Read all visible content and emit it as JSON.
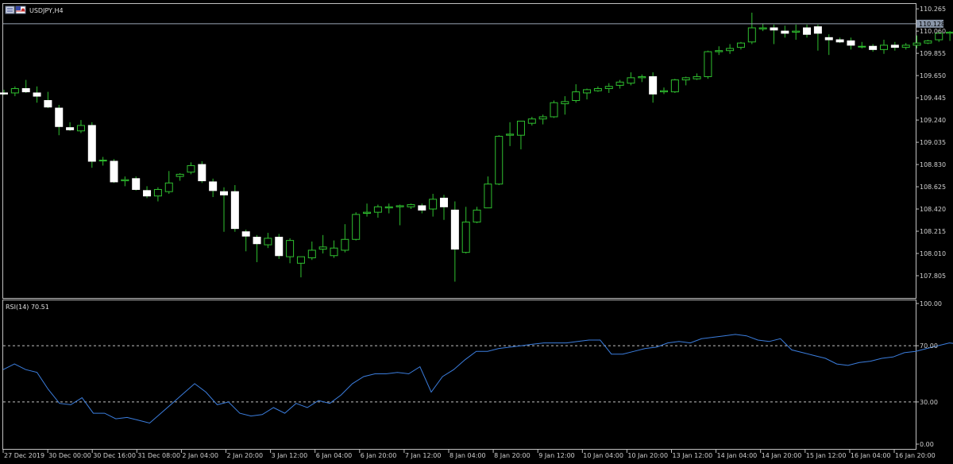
{
  "symbol_label": "USDJPY,H4",
  "rsi_label": "RSI(14) 70.51",
  "current_price_label": "110.128",
  "colors": {
    "background": "#000000",
    "frame": "#c0c0c0",
    "bull_fill": "#000000",
    "bull_stroke": "#2fbf2f",
    "bear_fill": "#ffffff",
    "wick": "#2fbf2f",
    "rsi_line": "#3b7ddd",
    "level_line": "#c0c0c0",
    "price_line": "#9aa7b6"
  },
  "chart_data": [
    {
      "type": "candlestick",
      "title": "USDJPY,H4",
      "ylim": [
        107.6,
        110.31
      ],
      "y_ticks": [
        "110.265",
        "110.060",
        "109.855",
        "109.650",
        "109.445",
        "109.240",
        "109.035",
        "108.830",
        "108.625",
        "108.420",
        "108.215",
        "108.010",
        "107.805"
      ],
      "current_price": 110.128,
      "x_tick_labels": [
        "27 Dec 2019",
        "30 Dec 00:00",
        "30 Dec 16:00",
        "31 Dec 08:00",
        "2 Jan 04:00",
        "2 Jan 20:00",
        "3 Jan 12:00",
        "6 Jan 04:00",
        "6 Jan 20:00",
        "7 Jan 12:00",
        "8 Jan 04:00",
        "8 Jan 20:00",
        "9 Jan 12:00",
        "10 Jan 04:00",
        "10 Jan 20:00",
        "13 Jan 12:00",
        "14 Jan 04:00",
        "14 Jan 20:00",
        "15 Jan 12:00",
        "16 Jan 04:00",
        "16 Jan 20:00"
      ],
      "candles": [
        {
          "o": 109.49,
          "h": 109.52,
          "l": 109.47,
          "c": 109.48
        },
        {
          "o": 109.49,
          "h": 109.55,
          "l": 109.46,
          "c": 109.53
        },
        {
          "o": 109.53,
          "h": 109.61,
          "l": 109.49,
          "c": 109.5
        },
        {
          "o": 109.49,
          "h": 109.55,
          "l": 109.4,
          "c": 109.46
        },
        {
          "o": 109.42,
          "h": 109.5,
          "l": 109.35,
          "c": 109.36
        },
        {
          "o": 109.35,
          "h": 109.38,
          "l": 109.1,
          "c": 109.18
        },
        {
          "o": 109.17,
          "h": 109.22,
          "l": 109.14,
          "c": 109.15
        },
        {
          "o": 109.14,
          "h": 109.24,
          "l": 109.12,
          "c": 109.19
        },
        {
          "o": 109.19,
          "h": 109.22,
          "l": 108.8,
          "c": 108.86
        },
        {
          "o": 108.87,
          "h": 108.9,
          "l": 108.82,
          "c": 108.87
        },
        {
          "o": 108.86,
          "h": 108.88,
          "l": 108.66,
          "c": 108.67
        },
        {
          "o": 108.68,
          "h": 108.72,
          "l": 108.63,
          "c": 108.69
        },
        {
          "o": 108.7,
          "h": 108.72,
          "l": 108.59,
          "c": 108.6
        },
        {
          "o": 108.59,
          "h": 108.63,
          "l": 108.52,
          "c": 108.54
        },
        {
          "o": 108.54,
          "h": 108.62,
          "l": 108.49,
          "c": 108.6
        },
        {
          "o": 108.58,
          "h": 108.77,
          "l": 108.56,
          "c": 108.66
        },
        {
          "o": 108.72,
          "h": 108.75,
          "l": 108.68,
          "c": 108.74
        },
        {
          "o": 108.76,
          "h": 108.85,
          "l": 108.74,
          "c": 108.82
        },
        {
          "o": 108.83,
          "h": 108.86,
          "l": 108.66,
          "c": 108.68
        },
        {
          "o": 108.67,
          "h": 108.7,
          "l": 108.53,
          "c": 108.59
        },
        {
          "o": 108.58,
          "h": 108.62,
          "l": 108.21,
          "c": 108.55
        },
        {
          "o": 108.58,
          "h": 108.64,
          "l": 108.21,
          "c": 108.24
        },
        {
          "o": 108.21,
          "h": 108.23,
          "l": 108.03,
          "c": 108.17
        },
        {
          "o": 108.16,
          "h": 108.18,
          "l": 107.93,
          "c": 108.1
        },
        {
          "o": 108.09,
          "h": 108.2,
          "l": 108.06,
          "c": 108.15
        },
        {
          "o": 108.16,
          "h": 108.19,
          "l": 107.96,
          "c": 107.99
        },
        {
          "o": 107.98,
          "h": 108.15,
          "l": 107.92,
          "c": 108.13
        },
        {
          "o": 107.92,
          "h": 107.96,
          "l": 107.79,
          "c": 107.98
        },
        {
          "o": 107.97,
          "h": 108.12,
          "l": 107.95,
          "c": 108.04
        },
        {
          "o": 108.05,
          "h": 108.18,
          "l": 108.01,
          "c": 108.07
        },
        {
          "o": 107.99,
          "h": 108.13,
          "l": 107.97,
          "c": 108.06
        },
        {
          "o": 108.04,
          "h": 108.28,
          "l": 108.02,
          "c": 108.14
        },
        {
          "o": 108.14,
          "h": 108.39,
          "l": 108.13,
          "c": 108.37
        },
        {
          "o": 108.38,
          "h": 108.47,
          "l": 108.35,
          "c": 108.39
        },
        {
          "o": 108.39,
          "h": 108.46,
          "l": 108.34,
          "c": 108.44
        },
        {
          "o": 108.43,
          "h": 108.47,
          "l": 108.38,
          "c": 108.44
        },
        {
          "o": 108.44,
          "h": 108.46,
          "l": 108.27,
          "c": 108.45
        },
        {
          "o": 108.44,
          "h": 108.47,
          "l": 108.42,
          "c": 108.46
        },
        {
          "o": 108.45,
          "h": 108.47,
          "l": 108.38,
          "c": 108.41
        },
        {
          "o": 108.42,
          "h": 108.56,
          "l": 108.35,
          "c": 108.51
        },
        {
          "o": 108.52,
          "h": 108.55,
          "l": 108.32,
          "c": 108.44
        },
        {
          "o": 108.41,
          "h": 108.49,
          "l": 107.75,
          "c": 108.05
        },
        {
          "o": 108.02,
          "h": 108.44,
          "l": 108.01,
          "c": 108.3
        },
        {
          "o": 108.3,
          "h": 108.44,
          "l": 108.29,
          "c": 108.41
        },
        {
          "o": 108.43,
          "h": 108.72,
          "l": 108.43,
          "c": 108.65
        },
        {
          "o": 108.65,
          "h": 109.1,
          "l": 108.64,
          "c": 109.09
        },
        {
          "o": 109.1,
          "h": 109.22,
          "l": 109.0,
          "c": 109.11
        },
        {
          "o": 109.1,
          "h": 109.23,
          "l": 108.97,
          "c": 109.23
        },
        {
          "o": 109.21,
          "h": 109.27,
          "l": 109.19,
          "c": 109.25
        },
        {
          "o": 109.25,
          "h": 109.29,
          "l": 109.2,
          "c": 109.27
        },
        {
          "o": 109.27,
          "h": 109.42,
          "l": 109.26,
          "c": 109.4
        },
        {
          "o": 109.39,
          "h": 109.46,
          "l": 109.29,
          "c": 109.41
        },
        {
          "o": 109.42,
          "h": 109.57,
          "l": 109.4,
          "c": 109.5
        },
        {
          "o": 109.49,
          "h": 109.53,
          "l": 109.43,
          "c": 109.52
        },
        {
          "o": 109.51,
          "h": 109.55,
          "l": 109.5,
          "c": 109.53
        },
        {
          "o": 109.53,
          "h": 109.58,
          "l": 109.49,
          "c": 109.55
        },
        {
          "o": 109.56,
          "h": 109.61,
          "l": 109.53,
          "c": 109.59
        },
        {
          "o": 109.58,
          "h": 109.68,
          "l": 109.56,
          "c": 109.63
        },
        {
          "o": 109.63,
          "h": 109.66,
          "l": 109.59,
          "c": 109.64
        },
        {
          "o": 109.64,
          "h": 109.68,
          "l": 109.4,
          "c": 109.48
        },
        {
          "o": 109.5,
          "h": 109.54,
          "l": 109.48,
          "c": 109.51
        },
        {
          "o": 109.5,
          "h": 109.62,
          "l": 109.49,
          "c": 109.61
        },
        {
          "o": 109.61,
          "h": 109.64,
          "l": 109.56,
          "c": 109.63
        },
        {
          "o": 109.62,
          "h": 109.67,
          "l": 109.61,
          "c": 109.64
        },
        {
          "o": 109.64,
          "h": 109.88,
          "l": 109.62,
          "c": 109.87
        },
        {
          "o": 109.87,
          "h": 109.92,
          "l": 109.84,
          "c": 109.88
        },
        {
          "o": 109.88,
          "h": 109.94,
          "l": 109.85,
          "c": 109.9
        },
        {
          "o": 109.91,
          "h": 109.96,
          "l": 109.89,
          "c": 109.95
        },
        {
          "o": 109.96,
          "h": 110.23,
          "l": 109.94,
          "c": 110.09
        },
        {
          "o": 110.08,
          "h": 110.13,
          "l": 110.06,
          "c": 110.09
        },
        {
          "o": 110.09,
          "h": 110.12,
          "l": 109.94,
          "c": 110.07
        },
        {
          "o": 110.06,
          "h": 110.11,
          "l": 110.0,
          "c": 110.04
        },
        {
          "o": 110.05,
          "h": 110.12,
          "l": 109.98,
          "c": 110.06
        },
        {
          "o": 110.09,
          "h": 110.12,
          "l": 110.0,
          "c": 110.03
        },
        {
          "o": 110.1,
          "h": 110.12,
          "l": 109.88,
          "c": 110.04
        },
        {
          "o": 110.0,
          "h": 110.03,
          "l": 109.84,
          "c": 109.98
        },
        {
          "o": 109.98,
          "h": 110.0,
          "l": 109.95,
          "c": 109.96
        },
        {
          "o": 109.97,
          "h": 110.0,
          "l": 109.89,
          "c": 109.93
        },
        {
          "o": 109.92,
          "h": 109.96,
          "l": 109.9,
          "c": 109.92
        },
        {
          "o": 109.92,
          "h": 109.94,
          "l": 109.87,
          "c": 109.89
        },
        {
          "o": 109.89,
          "h": 109.98,
          "l": 109.85,
          "c": 109.93
        },
        {
          "o": 109.93,
          "h": 109.96,
          "l": 109.88,
          "c": 109.91
        },
        {
          "o": 109.91,
          "h": 109.95,
          "l": 109.89,
          "c": 109.93
        },
        {
          "o": 109.93,
          "h": 110.02,
          "l": 109.9,
          "c": 109.95
        },
        {
          "o": 109.95,
          "h": 109.98,
          "l": 109.94,
          "c": 109.97
        },
        {
          "o": 109.98,
          "h": 110.06,
          "l": 109.96,
          "c": 110.04
        },
        {
          "o": 110.04,
          "h": 110.06,
          "l": 109.97,
          "c": 110.05
        },
        {
          "o": 110.04,
          "h": 110.18,
          "l": 110.02,
          "c": 110.15
        },
        {
          "o": 110.14,
          "h": 110.16,
          "l": 110.11,
          "c": 110.13
        }
      ]
    },
    {
      "type": "line",
      "title": "RSI(14) 70.51",
      "ylim": [
        0,
        100
      ],
      "y_ticks": [
        "100.00",
        "70.00",
        "30.00",
        "0.00"
      ],
      "levels": [
        70,
        30
      ],
      "series": [
        {
          "values": [
            53,
            57,
            53,
            51,
            39,
            29,
            28,
            33,
            22,
            22,
            18,
            19,
            17,
            15,
            22,
            29,
            36,
            43,
            37,
            28,
            30,
            22,
            20,
            21,
            26,
            22,
            29,
            26,
            31,
            29,
            35,
            43,
            48,
            50,
            50,
            51,
            50,
            55,
            37,
            48,
            53,
            60,
            66,
            66,
            68,
            69,
            70,
            71,
            72,
            72,
            72,
            73,
            74,
            74,
            64,
            64,
            66,
            68,
            69,
            72,
            73,
            72,
            75,
            76,
            77,
            78,
            77,
            74,
            73,
            75,
            67,
            65,
            63,
            61,
            57,
            56,
            58,
            59,
            61,
            62,
            65,
            66,
            68,
            70,
            72,
            71,
            70.51
          ]
        }
      ]
    }
  ]
}
